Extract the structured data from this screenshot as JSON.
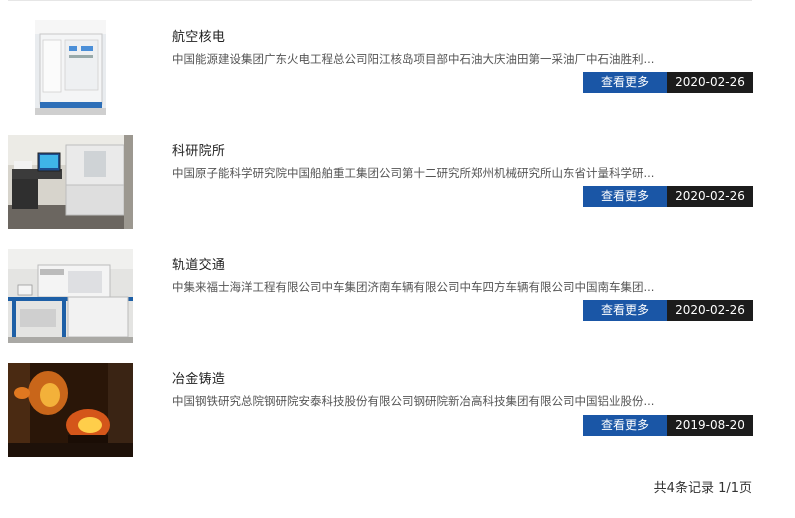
{
  "items": [
    {
      "title": "航空核电",
      "desc": "中国能源建设集团广东火电工程总公司阳江核岛项目部中石油大庆油田第一采油厂中石油胜利...",
      "more_label": "查看更多",
      "date": "2020-02-26",
      "thumb": "white-spectrometer-instrument"
    },
    {
      "title": "科研院所",
      "desc": "中国原子能科学研究院中国船舶重工集团公司第十二研究所郑州机械研究所山东省计量科学研...",
      "more_label": "查看更多",
      "date": "2020-02-26",
      "thumb": "lab-spectrometer-with-monitor"
    },
    {
      "title": "轨道交通",
      "desc": "中集来福士海洋工程有限公司中车集团济南车辆有限公司中车四方车辆有限公司中国南车集团...",
      "more_label": "查看更多",
      "date": "2020-02-26",
      "thumb": "spectrometer-on-blue-cart"
    },
    {
      "title": "冶金铸造",
      "desc": "中国钢铁研究总院钢研院安泰科技股份有限公司钢研院新冶高科技集团有限公司中国铝业股份...",
      "more_label": "查看更多",
      "date": "2019-08-20",
      "thumb": "molten-metal-foundry"
    }
  ],
  "pagination": {
    "text": "共4条记录 1/1页"
  },
  "colors": {
    "more_button": "#1a56a6",
    "date_badge": "#1c1c1c"
  }
}
